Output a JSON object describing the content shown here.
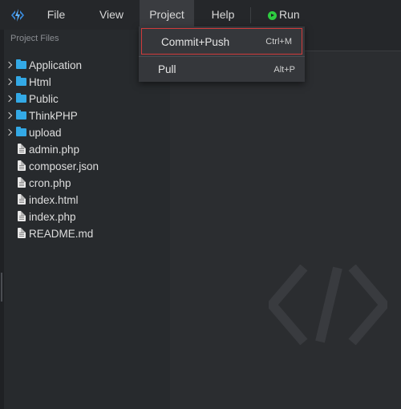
{
  "menubar": {
    "items": [
      "File",
      "View",
      "Project",
      "Help"
    ],
    "run_label": "Run"
  },
  "sidebar": {
    "title": "Project Files",
    "tree": [
      {
        "type": "folder",
        "label": "Application"
      },
      {
        "type": "folder",
        "label": "Html"
      },
      {
        "type": "folder",
        "label": "Public"
      },
      {
        "type": "folder",
        "label": "ThinkPHP"
      },
      {
        "type": "folder",
        "label": "upload"
      },
      {
        "type": "file",
        "label": "admin.php"
      },
      {
        "type": "file",
        "label": "composer.json"
      },
      {
        "type": "file",
        "label": "cron.php"
      },
      {
        "type": "file",
        "label": "index.html"
      },
      {
        "type": "file",
        "label": "index.php"
      },
      {
        "type": "file",
        "label": "README.md"
      }
    ]
  },
  "dropdown": {
    "items": [
      {
        "label": "Commit+Push",
        "shortcut": "Ctrl+M"
      },
      {
        "label": "Pull",
        "shortcut": "Alt+P"
      }
    ]
  },
  "colors": {
    "accent_folder": "#33a9e6",
    "run_green": "#2ecc40",
    "highlight_border": "#d13b3b"
  }
}
